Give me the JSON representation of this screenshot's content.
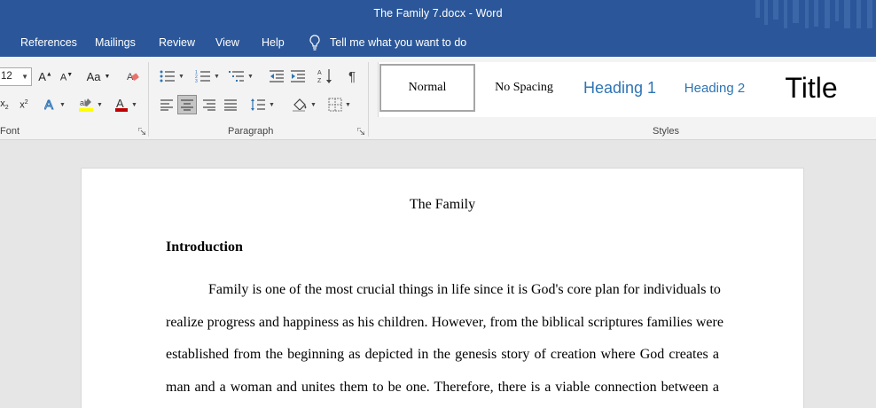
{
  "window": {
    "title": "The Family 7.docx  -  Word"
  },
  "menu": {
    "tabs": [
      "References",
      "Mailings",
      "Review",
      "View",
      "Help"
    ],
    "tell_me": "Tell me what you want to do"
  },
  "ribbon": {
    "font_size": "12",
    "font_group_label": "Font",
    "paragraph_group_label": "Paragraph",
    "styles_group_label": "Styles",
    "case_button": "Aa",
    "styles": [
      "Normal",
      "No Spacing",
      "Heading 1",
      "Heading 2",
      "Title"
    ],
    "selected_style": "Normal"
  },
  "colors": {
    "titlebar": "#2b579a",
    "ribbon": "#f3f3f3",
    "heading_blue": "#2e74b5",
    "font_color_red": "#c00000",
    "highlight_yellow": "#ffff00"
  },
  "document": {
    "title": "The Family",
    "heading": "Introduction",
    "lines": [
      "Family is one of the most crucial things in life since it is God's core plan for individuals to",
      "realize progress and happiness as his children. However, from the biblical scriptures families were",
      "established from the beginning as depicted in the genesis story of creation where God creates a",
      "man and a woman and unites them to be one. Therefore, there is a viable connection between a"
    ]
  }
}
